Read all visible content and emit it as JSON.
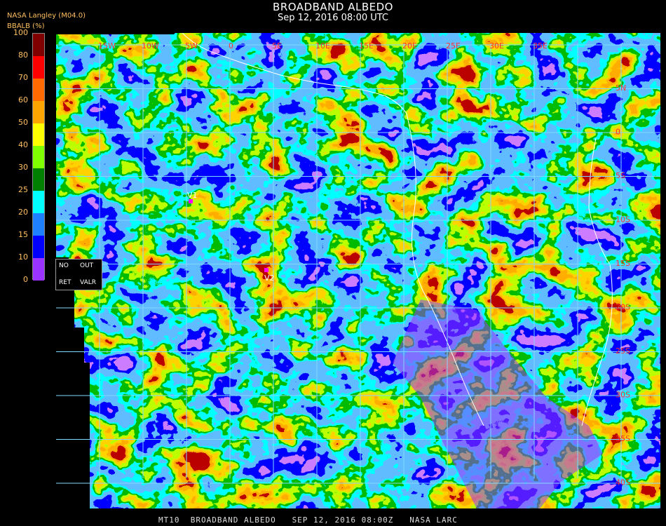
{
  "header": {
    "title": "BROADBAND ALBEDO",
    "subtitle": "Sep 12, 2016 08:00 UTC",
    "source": "NASA Langley (M04.0)",
    "colorbar_label": "BBALB (%)"
  },
  "colorbar": {
    "ticks": [
      "100",
      "80",
      "70",
      "60",
      "50",
      "40",
      "30",
      "25",
      "20",
      "15",
      "10",
      "0"
    ],
    "bands": [
      {
        "from": 0,
        "to": 10,
        "color": "#9a33ff"
      },
      {
        "from": 10,
        "to": 15,
        "color": "#0000ff"
      },
      {
        "from": 15,
        "to": 20,
        "color": "#1e7fff"
      },
      {
        "from": 20,
        "to": 25,
        "color": "#00ffff"
      },
      {
        "from": 25,
        "to": 30,
        "color": "#008000"
      },
      {
        "from": 30,
        "to": 40,
        "color": "#80ff00"
      },
      {
        "from": 40,
        "to": 50,
        "color": "#ffff00"
      },
      {
        "from": 50,
        "to": 60,
        "color": "#ffa500"
      },
      {
        "from": 60,
        "to": 70,
        "color": "#ff6a00"
      },
      {
        "from": 70,
        "to": 80,
        "color": "#ff0000"
      },
      {
        "from": 80,
        "to": 100,
        "color": "#800000"
      }
    ]
  },
  "legend": {
    "no": "NO",
    "out": "OUT",
    "ret": "RET",
    "valr": "VALR"
  },
  "map": {
    "lon_labels": [
      "15W",
      "10W",
      "5W",
      "0",
      "5E",
      "10E",
      "15E",
      "20E",
      "25E",
      "30E",
      "35E"
    ],
    "lat_labels": [
      "5N",
      "0",
      "5S",
      "10S",
      "15S",
      "20S",
      "25S",
      "30S",
      "35S",
      "40S"
    ],
    "sites": [
      {
        "label": "V1",
        "color": "#ff00ff"
      },
      {
        "label": "V2",
        "color": "#ff00ff"
      }
    ],
    "grid_color": "#7fd8ff",
    "label_color": "#ff3030"
  },
  "footer": "MT10  BROADBAND ALBEDO   SEP 12, 2016 08:00Z   NASA LARC"
}
